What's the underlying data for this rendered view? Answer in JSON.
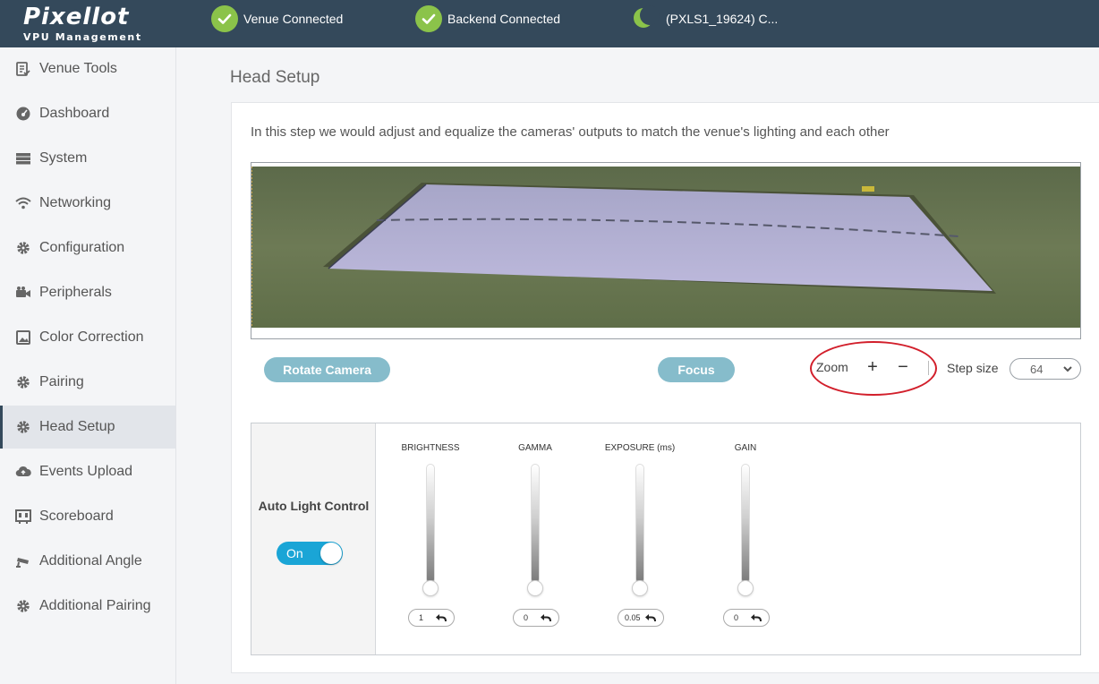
{
  "header": {
    "logo_main": "Pixellot",
    "logo_sub": "VPU Management",
    "venue_status": "Venue Connected",
    "backend_status": "Backend Connected",
    "device_status": "(PXLS1_19624) C..."
  },
  "sidebar": {
    "items": [
      {
        "label": "Venue Tools",
        "icon": "checklist-icon"
      },
      {
        "label": "Dashboard",
        "icon": "gauge-icon"
      },
      {
        "label": "System",
        "icon": "server-icon"
      },
      {
        "label": "Networking",
        "icon": "wifi-icon"
      },
      {
        "label": "Configuration",
        "icon": "gear-icon"
      },
      {
        "label": "Peripherals",
        "icon": "video-camera-icon"
      },
      {
        "label": "Color Correction",
        "icon": "image-icon"
      },
      {
        "label": "Pairing",
        "icon": "gear-icon"
      },
      {
        "label": "Head Setup",
        "icon": "gear-icon"
      },
      {
        "label": "Events Upload",
        "icon": "cloud-upload-icon"
      },
      {
        "label": "Scoreboard",
        "icon": "scoreboard-icon"
      },
      {
        "label": "Additional Angle",
        "icon": "security-camera-icon"
      },
      {
        "label": "Additional Pairing",
        "icon": "gear-icon"
      }
    ],
    "active_index": 8
  },
  "main": {
    "title": "Head Setup",
    "intro": "In this step we would adjust and equalize the cameras' outputs to match the venue's lighting and each other",
    "rotate_label": "Rotate Camera",
    "focus_label": "Focus",
    "zoom_label": "Zoom",
    "zoom_in": "+",
    "zoom_out": "−",
    "step_label": "Step size",
    "step_value": "64"
  },
  "light_panel": {
    "auto_label": "Auto Light Control",
    "toggle_label": "On",
    "sliders": [
      {
        "label": "BRIGHTNESS",
        "value": "1"
      },
      {
        "label": "GAMMA",
        "value": "0"
      },
      {
        "label": "EXPOSURE (ms)",
        "value": "0.05"
      },
      {
        "label": "GAIN",
        "value": "0"
      }
    ]
  },
  "colors": {
    "topbar": "#34495b",
    "status_green": "#8bc34a",
    "button": "#86bccb",
    "toggle_on": "#1aa5d6",
    "annotation_red": "#d21f2b"
  }
}
